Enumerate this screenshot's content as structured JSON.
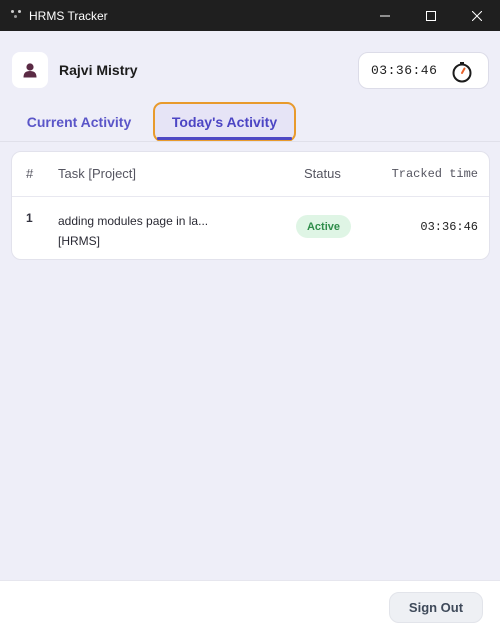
{
  "window": {
    "title": "HRMS Tracker",
    "controls": [
      "minimize-icon",
      "maximize-icon",
      "close-icon"
    ]
  },
  "user": {
    "name": "Rajvi Mistry",
    "avatar_icon": "person-icon"
  },
  "timer": {
    "value": "03:36:46",
    "icon": "stopwatch-icon"
  },
  "tabs": [
    {
      "label": "Current Activity",
      "active": false
    },
    {
      "label": "Today's Activity",
      "active": true
    }
  ],
  "table": {
    "headers": {
      "num": "#",
      "task": "Task [Project]",
      "status": "Status",
      "time": "Tracked time"
    },
    "rows": [
      {
        "num": "1",
        "task": "adding modules page in la...",
        "project": "[HRMS]",
        "status": "Active",
        "time": "03:36:46"
      }
    ]
  },
  "footer": {
    "sign_out_label": "Sign Out"
  },
  "colors": {
    "accent": "#5a55c8",
    "tab_highlight_border": "#e89a2c",
    "status_active_bg": "#dff5e5",
    "status_active_text": "#2f8d4a",
    "avatar_color": "#5a2a44"
  }
}
